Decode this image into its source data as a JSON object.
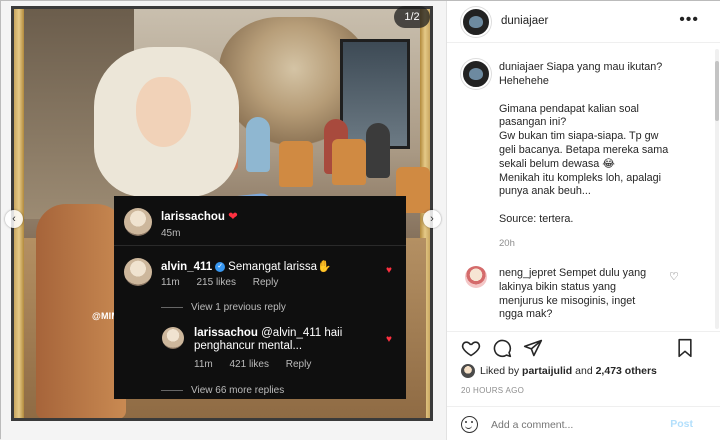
{
  "media": {
    "counter": "1/2",
    "watermark": "@MIMI.JULID",
    "overlay": {
      "post_author": "larissachou",
      "post_emoji": "❤",
      "post_time": "45m",
      "comment": {
        "author": "alvin_411",
        "text": "Semangat larissa✋",
        "time": "11m",
        "likes": "215 likes",
        "reply_label": "Reply"
      },
      "view_previous": "View 1 previous reply",
      "reply": {
        "author": "larissachou",
        "text_line1": "@alvin_411 haii",
        "text_line2": "penghancur mental...",
        "time": "11m",
        "likes": "421 likes",
        "reply_label": "Reply"
      },
      "view_more": "View 66 more replies"
    }
  },
  "header": {
    "username": "duniajaer",
    "more_icon": "more-dots-icon"
  },
  "caption": {
    "username": "duniajaer",
    "first_line": "Siapa yang mau ikutan?",
    "body": "Hehehehe\n\nGimana pendapat kalian soal\npasangan ini?\nGw bukan tim siapa-siapa. Tp gw\ngeli bacanya. Betapa mereka sama\nsekali belum dewasa 😂\nMenikah itu kompleks loh, apalagi\npunya anak beuh...\n\nSource: tertera.",
    "time": "20h"
  },
  "comment": {
    "username": "neng_jepret",
    "text": "Sempet dulu yang\nlakinya bikin status yang\nmenjurus ke misoginis, inget\nngga mak?"
  },
  "actions": {
    "liked_prefix": "Liked by",
    "liked_user": "partaijulid",
    "liked_and": "and",
    "liked_others": "2,473 others",
    "ago": "20 HOURS AGO"
  },
  "add_comment": {
    "placeholder": "Add a comment...",
    "post_label": "Post"
  },
  "colors": {
    "accent": "#3897f0",
    "like_red": "#ff3040",
    "post_disabled": "#b2dffc"
  }
}
